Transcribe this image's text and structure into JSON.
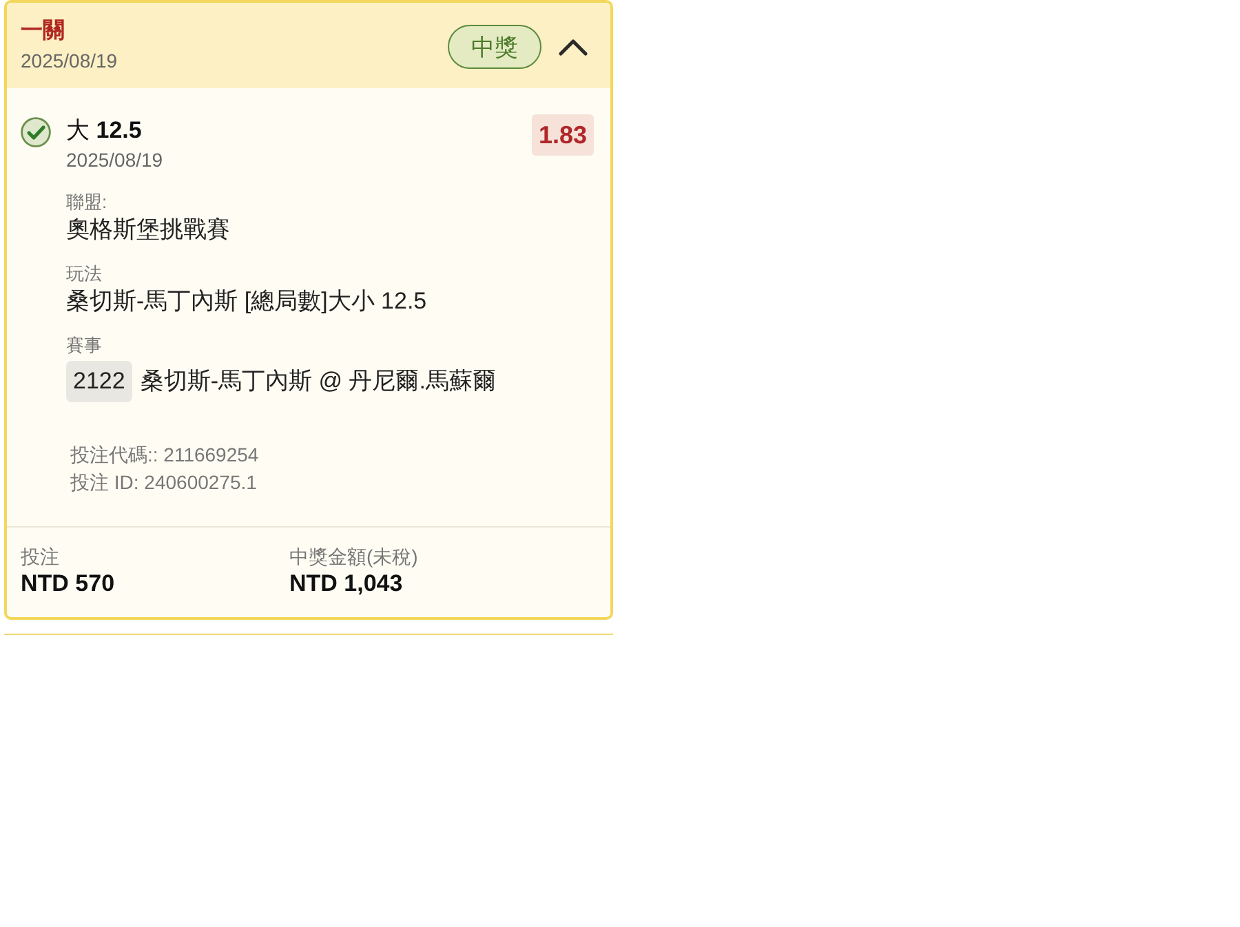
{
  "ticket": {
    "title": "一關",
    "date": "2025/08/19",
    "status": {
      "label": "中獎",
      "kind": "won"
    },
    "expanded": true
  },
  "selection": {
    "won": true,
    "pick": "大 **12.5**",
    "date": "2025/08/19",
    "odds": "1.83"
  },
  "details": [
    {
      "label": "聯盟:",
      "value": "奧格斯堡挑戰賽"
    },
    {
      "label": "玩法",
      "value": "桑切斯-馬丁內斯 [總局數]大小 12.5"
    },
    {
      "label": "賽事",
      "code": "2122",
      "value": "桑切斯-馬丁內斯 @ 丹尼爾.馬蘇爾"
    }
  ],
  "references": [
    "投注代碼:: 211669254",
    "投注 ID: 240600275.1"
  ],
  "totals": [
    {
      "label": "投注",
      "value": "NTD 570"
    },
    {
      "label": "中獎金額(未稅)",
      "value": "NTD 1,043"
    }
  ]
}
